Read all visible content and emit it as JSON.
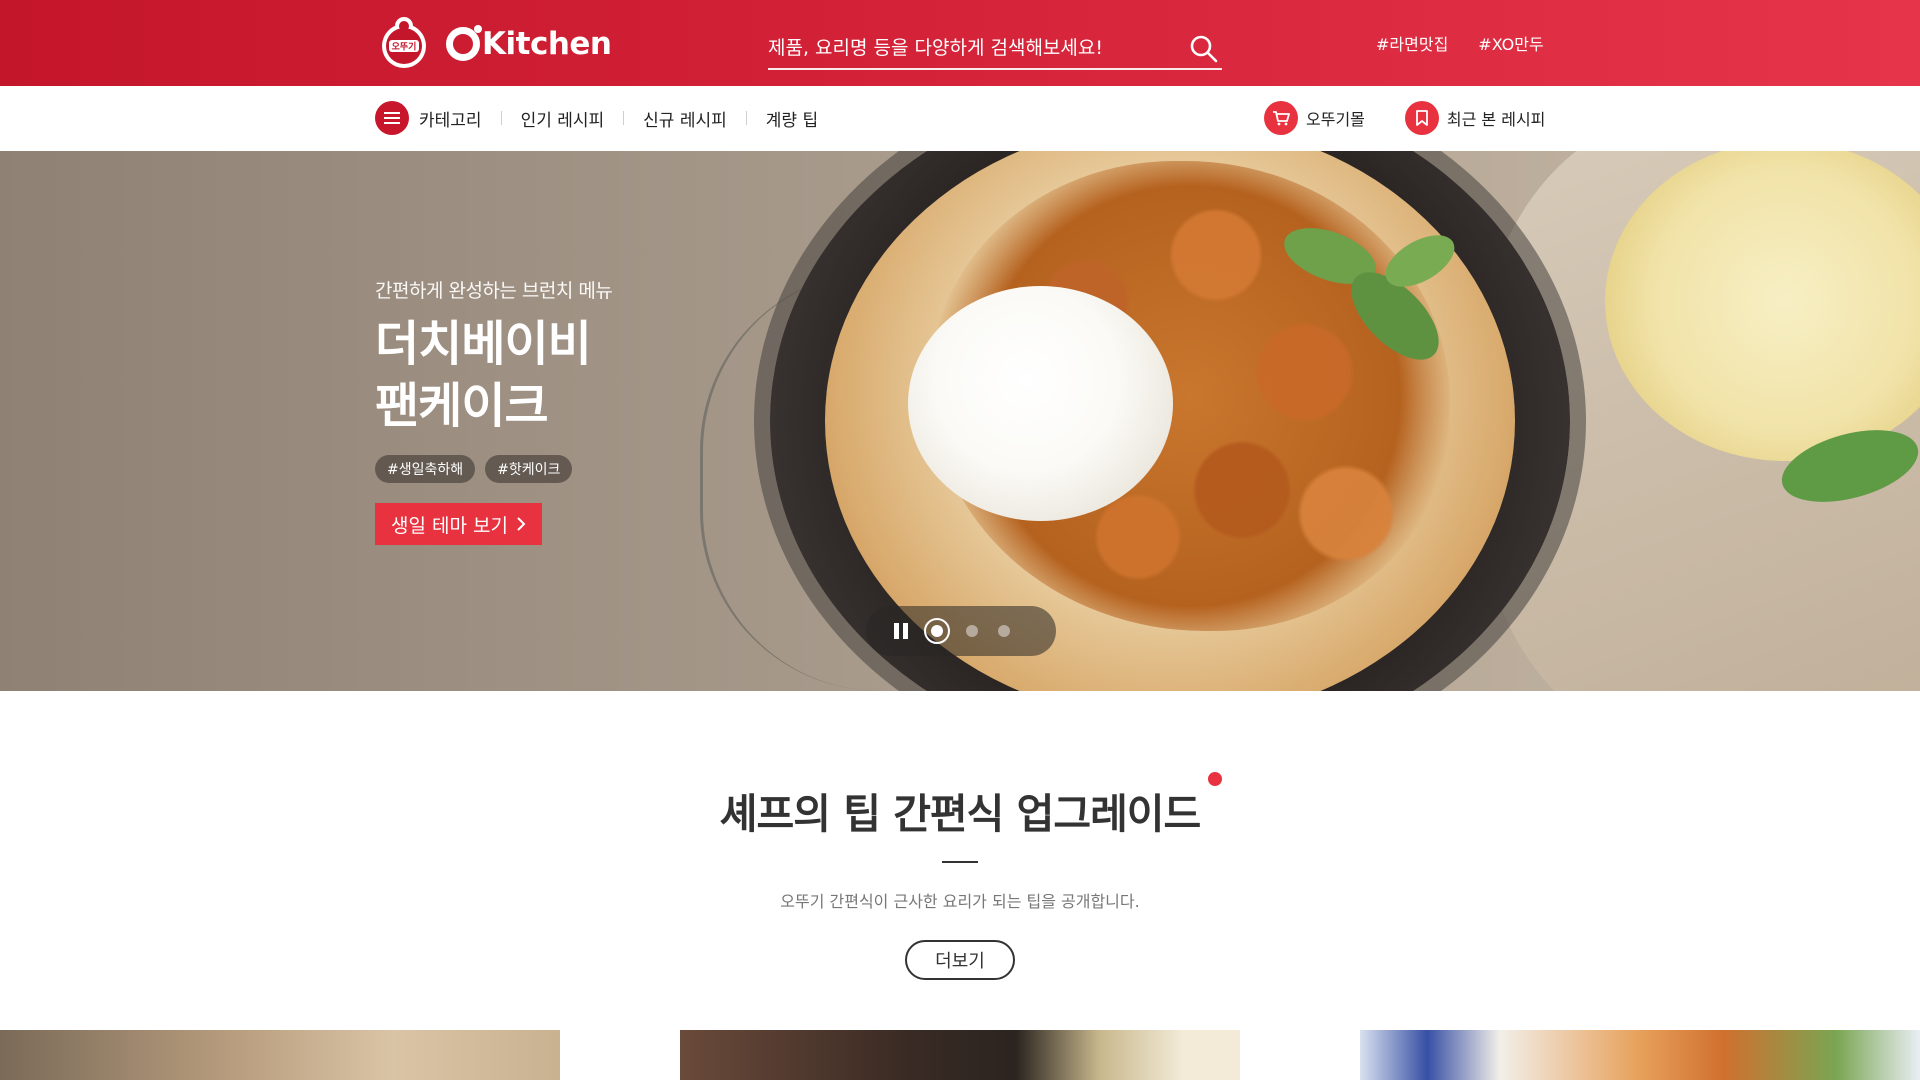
{
  "header": {
    "brand_seal_text": "오뚜기",
    "brand_name": "Kitchen",
    "search_placeholder": "제품, 요리명 등을 다양하게 검색해보세요!",
    "hashtags": [
      "#라면맛집",
      "#XO만두"
    ]
  },
  "nav": {
    "items": [
      "카테고리",
      "인기 레시피",
      "신규 레시피",
      "계량 팁"
    ],
    "right": [
      "오뚜기몰",
      "최근 본 레시피"
    ]
  },
  "hero": {
    "subtitle": "간편하게 완성하는 브런치 메뉴",
    "title_line1": "더치베이비",
    "title_line2": "팬케이크",
    "tags": [
      "#생일축하해",
      "#핫케이크"
    ],
    "cta": "생일 테마 보기"
  },
  "section": {
    "title": "셰프의 팁 간편식 업그레이드",
    "desc": "오뚜기 간편식이 근사한 요리가 되는 팁을 공개합니다.",
    "more": "더보기"
  },
  "colors": {
    "brand_red": "#c4162b",
    "accent_red": "#e8323f"
  }
}
